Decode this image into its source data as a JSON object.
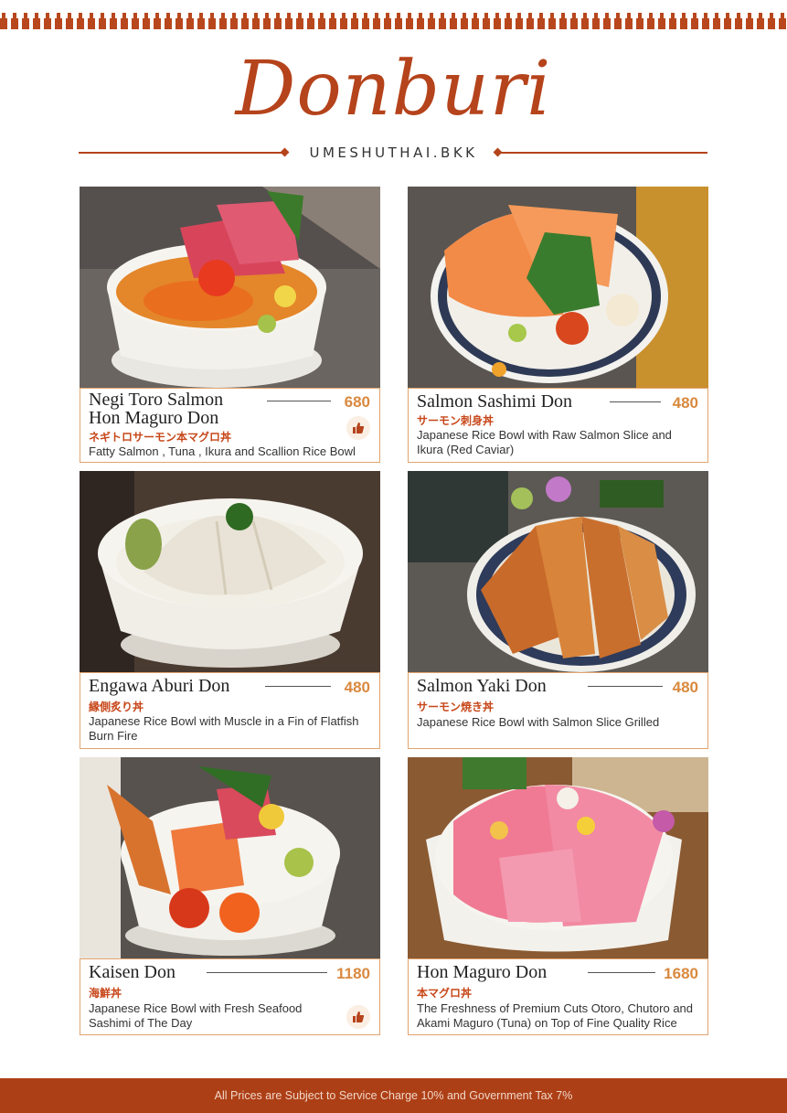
{
  "header": {
    "title": "Donburi",
    "subtitle": "UMESHUTHAI.BKK"
  },
  "colors": {
    "accent": "#b5431b",
    "price": "#d9893f",
    "card_border": "#e1a46f"
  },
  "items": [
    {
      "name_line1": "Negi Toro Salmon",
      "name_line2": "Hon Maguro Don",
      "price": "680",
      "jp": "ネギトロサーモン本マグロ丼",
      "desc": "Fatty Salmon , Tuna , Ikura and Scallion Rice Bowl",
      "recommended": true,
      "icon": "thumbs-up-badge-icon"
    },
    {
      "name_line1": "Salmon Sashimi Don",
      "price": "480",
      "jp": "サーモン刺身丼",
      "desc": "Japanese Rice Bowl with Raw Salmon Slice and Ikura (Red Caviar)",
      "recommended": false
    },
    {
      "name_line1": "Engawa Aburi Don",
      "price": "480",
      "jp": "縁側炙り丼",
      "desc": "Japanese Rice Bowl with Muscle in a Fin of Flatfish Burn Fire",
      "recommended": false
    },
    {
      "name_line1": "Salmon Yaki Don",
      "price": "480",
      "jp": "サーモン焼き丼",
      "desc": "Japanese Rice Bowl with Salmon Slice Grilled",
      "recommended": false
    },
    {
      "name_line1": "Kaisen Don",
      "price": "1180",
      "jp": "海鮮丼",
      "desc": "Japanese Rice Bowl with Fresh Seafood Sashimi of The Day",
      "recommended": true,
      "icon": "thumbs-up-badge-icon"
    },
    {
      "name_line1": "Hon Maguro Don",
      "price": "1680",
      "jp": "本マグロ丼",
      "desc": "The Freshness of Premium Cuts Otoro, Chutoro and Akami Maguro (Tuna) on Top of Fine Quality Rice",
      "recommended": false
    }
  ],
  "footer": {
    "note": "All Prices are Subject to Service Charge 10% and Government Tax 7%"
  }
}
